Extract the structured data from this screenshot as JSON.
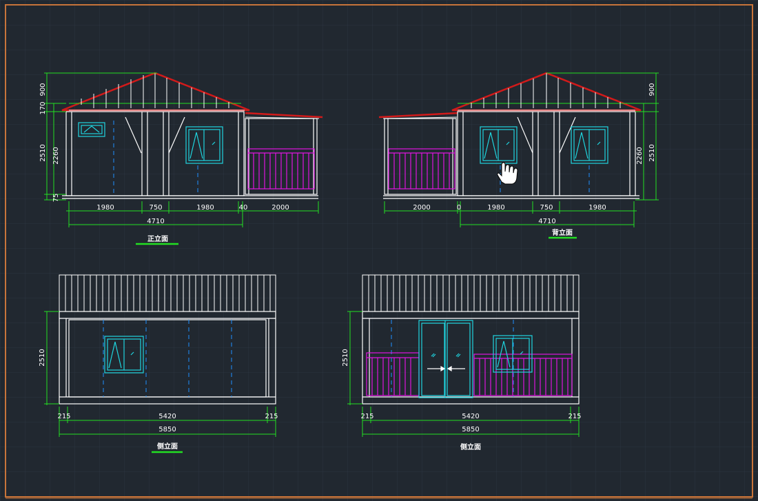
{
  "colors": {
    "background": "#212830",
    "grid": "#2c3541",
    "border": "#c8743a",
    "walls": "#ffffff",
    "dimension": "#22e022",
    "roof": "#d21a1a",
    "window": "#1fd6e0",
    "railing": "#e015e0",
    "hidden_line": "#1e90ff"
  },
  "cursor_icon": "hand-pointer-icon",
  "front_elevation": {
    "title": "正立面",
    "widths": [
      "1980",
      "750",
      "1980",
      "40",
      "2000"
    ],
    "total": "4710",
    "heights": [
      "900",
      "170",
      "2510",
      "2260",
      "75"
    ]
  },
  "back_elevation": {
    "title": "背立面",
    "widths": [
      "2000",
      "0",
      "1980",
      "750",
      "1980"
    ],
    "total": "4710",
    "heights": [
      "900",
      "2510",
      "2260"
    ]
  },
  "left_side_elevation": {
    "title": "侧立面",
    "height": "2510",
    "widths": [
      "215",
      "5420",
      "215"
    ],
    "total": "5850"
  },
  "right_side_elevation": {
    "title": "侧立面",
    "height": "2510",
    "widths": [
      "215",
      "5420",
      "215"
    ],
    "total": "5850"
  }
}
